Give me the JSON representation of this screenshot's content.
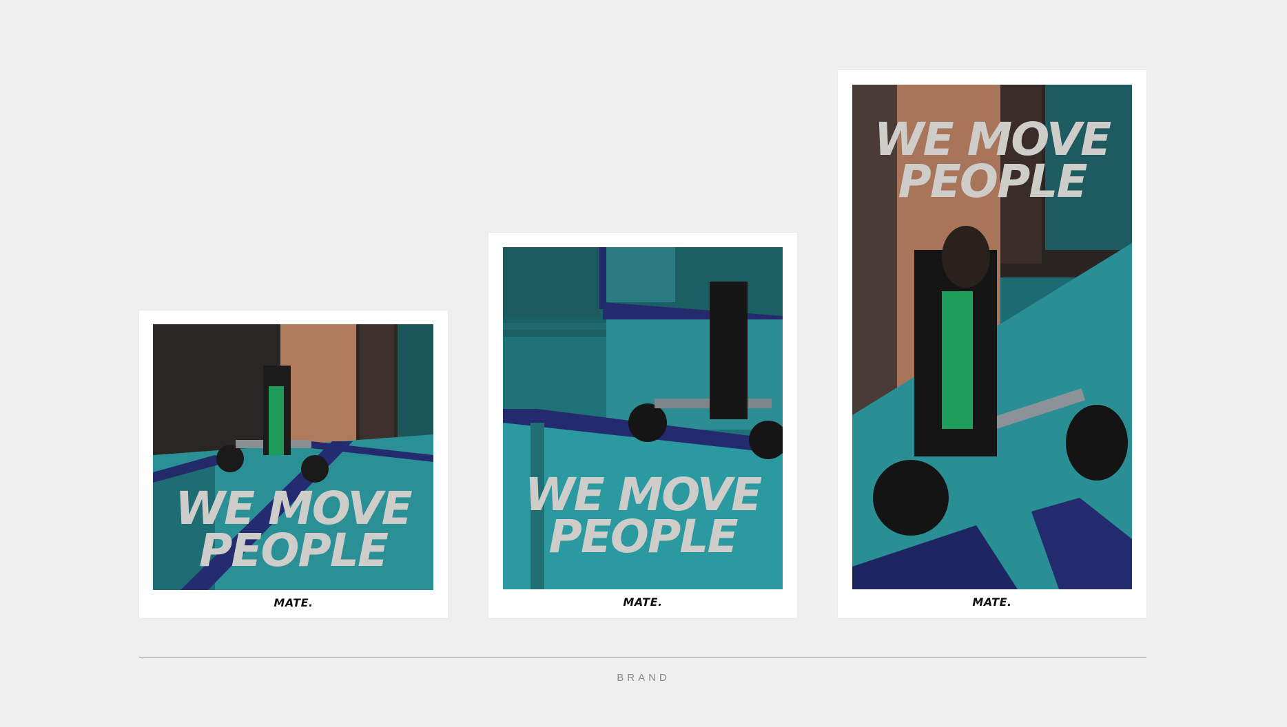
{
  "posters": [
    {
      "headline_line1": "WE MOVE",
      "headline_line2": "PEOPLE",
      "logo": "MATE."
    },
    {
      "headline_line1": "WE MOVE",
      "headline_line2": "PEOPLE",
      "logo": "MATE."
    },
    {
      "headline_line1": "WE MOVE",
      "headline_line2": "PEOPLE",
      "logo": "MATE."
    }
  ],
  "footer": {
    "label": "BRAND"
  },
  "colors": {
    "background": "#efefef",
    "card": "#ffffff",
    "teal": "#1f6a6e",
    "headline": "#cfcdca"
  }
}
